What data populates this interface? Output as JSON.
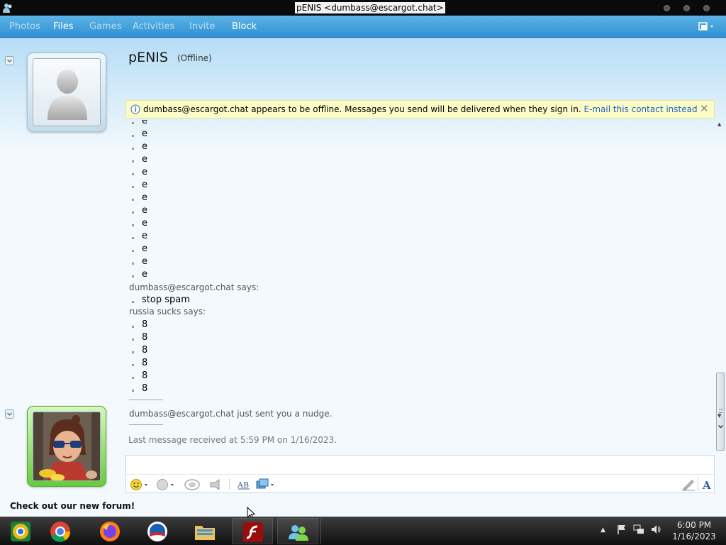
{
  "window": {
    "title": "pENIS <dumbass@escargot.chat>"
  },
  "menu": {
    "items": [
      "Photos",
      "Files",
      "Games",
      "Activities",
      "Invite",
      "Block"
    ]
  },
  "contact": {
    "name": "pENIS",
    "status": "(Offline)"
  },
  "infobar": {
    "message": "dumbass@escargot.chat appears to be offline. Messages you send will be delivered when they sign in.",
    "link": "E-mail this contact instead",
    "close": "✕"
  },
  "history": {
    "spam_lines": [
      "e",
      "e",
      "e",
      "e",
      "e",
      "e",
      "e",
      "e",
      "e",
      "e",
      "e",
      "e",
      "e"
    ],
    "sender1": "dumbass@escargot.chat says:",
    "sender1_message": "stop spam",
    "sender2": "russia sucks says:",
    "sender2_lines": [
      "8",
      "8",
      "8",
      "8",
      "8",
      "8"
    ],
    "nudge": "dumbass@escargot.chat just sent you a nudge.",
    "last_received": "Last message received at 5:59 PM on 1/16/2023."
  },
  "composer": {
    "value": "",
    "placeholder": ""
  },
  "footer": {
    "forum_link": "Check out our new forum!"
  },
  "taskbar": {
    "apps": [
      "chrome-canary-icon",
      "chrome-icon",
      "firefox-icon",
      "obama-logo-icon",
      "file-explorer-icon",
      "flash-icon",
      "messenger-icon"
    ],
    "time": "6:00 PM",
    "date": "1/16/2023"
  }
}
